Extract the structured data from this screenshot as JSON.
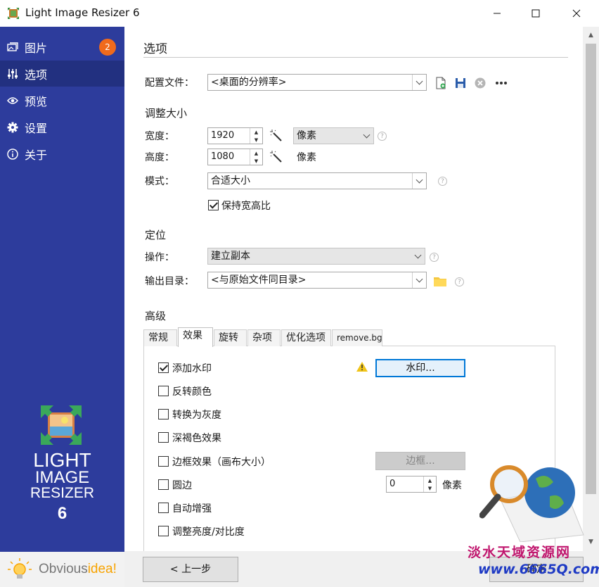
{
  "window": {
    "title": "Light Image Resizer 6"
  },
  "sidebar": {
    "items": [
      {
        "label": "图片",
        "badge": "2",
        "icon": "images-icon"
      },
      {
        "label": "选项",
        "icon": "sliders-icon"
      },
      {
        "label": "预览",
        "icon": "eye-icon"
      },
      {
        "label": "设置",
        "icon": "gear-icon"
      },
      {
        "label": "关于",
        "icon": "info-icon"
      }
    ],
    "logo_lines": [
      "LIGHT",
      "IMAGE",
      "RESIZER",
      "6"
    ],
    "brand_a": "Obvious",
    "brand_b": "idea!"
  },
  "main": {
    "title": "选项",
    "profile_label": "配置文件：",
    "profile_value": "<桌面的分辨率>",
    "resize_head": "调整大小",
    "width_label": "宽度：",
    "width_value": "1920",
    "height_label": "高度：",
    "height_value": "1080",
    "unit_select": "像素",
    "unit_text": "像素",
    "mode_label": "模式：",
    "mode_value": "合适大小",
    "keep_ratio": "保持宽高比",
    "target_head": "定位",
    "action_label": "操作：",
    "action_value": "建立副本",
    "output_label": "输出目录：",
    "output_value": "<与原始文件同目录>",
    "advanced_head": "高级",
    "tabs": [
      "常规",
      "效果",
      "旋转",
      "杂项",
      "优化选项",
      "remove.bg"
    ],
    "effects": {
      "watermark": "添加水印",
      "watermark_btn": "水印...",
      "invert": "反转颜色",
      "grayscale": "转换为灰度",
      "sepia": "深褐色效果",
      "border": "边框效果（画布大小）",
      "border_btn": "边框...",
      "round": "圆边",
      "round_value": "0",
      "round_unit": "像素",
      "auto_enhance": "自动增强",
      "brightness": "调整亮度/对比度"
    },
    "back_btn": "< 上一步",
    "next_btn": "确定"
  },
  "overlay": {
    "watermark_cn": "淡水天域资源网",
    "watermark_url": "www.6665Q.com"
  }
}
